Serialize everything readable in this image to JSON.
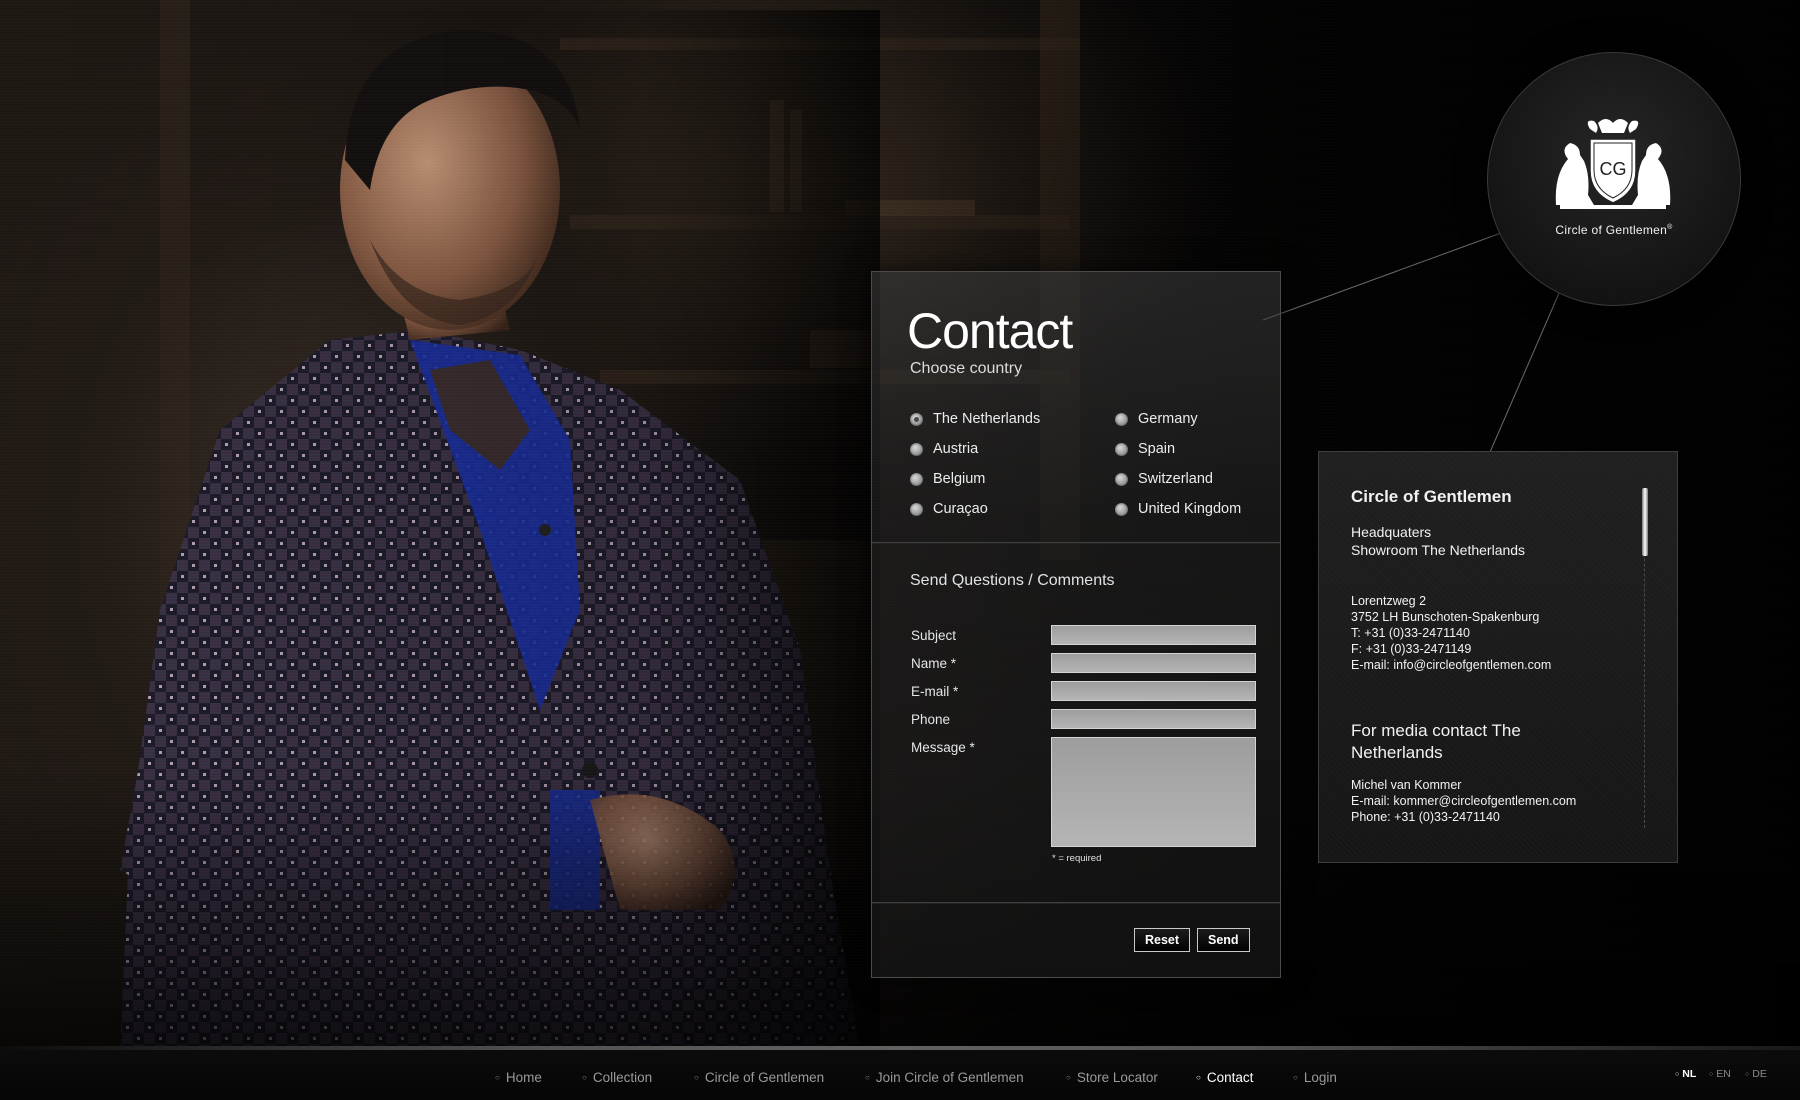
{
  "brand": {
    "name": "Circle of Gentlemen",
    "monogram": "CG",
    "registered": "®"
  },
  "contact": {
    "title": "Contact",
    "choose_country_label": "Choose country",
    "countries": [
      {
        "label": "The Netherlands",
        "selected": true
      },
      {
        "label": "Austria",
        "selected": false
      },
      {
        "label": "Belgium",
        "selected": false
      },
      {
        "label": "Curaçao",
        "selected": false
      },
      {
        "label": "Germany",
        "selected": false
      },
      {
        "label": "Spain",
        "selected": false
      },
      {
        "label": "Switzerland",
        "selected": false
      },
      {
        "label": "United Kingdom",
        "selected": false
      }
    ],
    "form": {
      "heading": "Send Questions / Comments",
      "subject_label": "Subject",
      "name_label": "Name *",
      "email_label": "E-mail *",
      "phone_label": "Phone",
      "message_label": "Message *",
      "subject_value": "",
      "name_value": "",
      "email_value": "",
      "phone_value": "",
      "message_value": "",
      "required_note": "* = required",
      "reset_label": "Reset",
      "send_label": "Send"
    }
  },
  "info": {
    "title": "Circle of Gentlemen",
    "hq_line1": "Headquaters",
    "hq_line2": "Showroom The Netherlands",
    "address_street": "Lorentzweg 2",
    "address_city": "3752 LH Bunschoten-Spakenburg",
    "phone": "T:  +31 (0)33-2471140",
    "fax": "F:  +31 (0)33-2471149",
    "email": "E-mail: info@circleofgentlemen.com",
    "media_heading_line1": "For media contact The",
    "media_heading_line2": "Netherlands",
    "media_name": "Michel van Kommer",
    "media_email": "E-mail: kommer@circleofgentlemen.com",
    "media_phone": "Phone:  +31 (0)33-2471140"
  },
  "nav": {
    "items": [
      {
        "label": "Home",
        "active": false
      },
      {
        "label": "Collection",
        "active": false
      },
      {
        "label": "Circle of Gentlemen",
        "active": false
      },
      {
        "label": "Join Circle of Gentlemen",
        "active": false
      },
      {
        "label": "Store Locator",
        "active": false
      },
      {
        "label": "Contact",
        "active": true
      },
      {
        "label": "Login",
        "active": false
      }
    ],
    "bullet": "○"
  },
  "languages": [
    {
      "code": "NL",
      "active": true
    },
    {
      "code": "EN",
      "active": false
    },
    {
      "code": "DE",
      "active": false
    }
  ],
  "colors": {
    "background": "#060606",
    "panel_border": "#4b4b4b",
    "field": "#b0b0b0",
    "text": "#e6e6e6",
    "shirt_blue": "#1a2fa0"
  }
}
